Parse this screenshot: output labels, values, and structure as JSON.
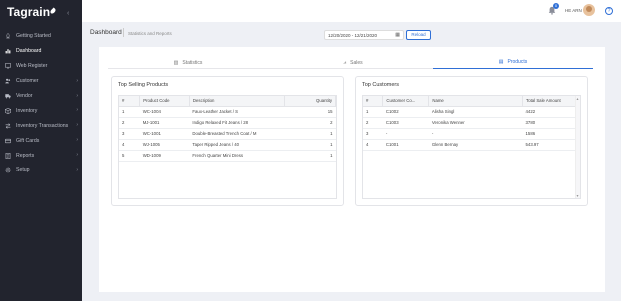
{
  "app": {
    "logo_text": "Tagrain"
  },
  "sidebar": {
    "items": [
      {
        "label": "Getting Started",
        "icon": "rocket-icon",
        "chevron": false
      },
      {
        "label": "Dashboard",
        "icon": "bar-chart-icon",
        "chevron": false,
        "active": true
      },
      {
        "label": "Web Register",
        "icon": "monitor-icon",
        "chevron": false
      },
      {
        "label": "Customer",
        "icon": "users-icon",
        "chevron": true
      },
      {
        "label": "Vendor",
        "icon": "truck-icon",
        "chevron": true
      },
      {
        "label": "Inventory",
        "icon": "box-icon",
        "chevron": true
      },
      {
        "label": "Inventory Transactions",
        "icon": "swap-icon",
        "chevron": true
      },
      {
        "label": "Gift Cards",
        "icon": "gift-card-icon",
        "chevron": true
      },
      {
        "label": "Reports",
        "icon": "report-icon",
        "chevron": true
      },
      {
        "label": "Setup",
        "icon": "gear-icon",
        "chevron": true
      }
    ]
  },
  "header": {
    "notification_count": "0",
    "user_name": "HE ARN",
    "help_label": "?"
  },
  "page": {
    "title": "Dashboard",
    "subtitle": "Statistics and Reports",
    "date_range": "12/20/2020 - 12/21/2020",
    "reload_label": "Reload"
  },
  "tabs": [
    {
      "label": "Statistics",
      "icon": "stats-icon"
    },
    {
      "label": "Sales",
      "icon": "line-chart-icon"
    },
    {
      "label": "Products",
      "icon": "products-icon",
      "active": true
    }
  ],
  "top_selling": {
    "title": "Top Selling Products",
    "columns": [
      "#",
      "Product Code",
      "Description",
      "Quantity"
    ],
    "rows": [
      [
        "1",
        "WC-1004",
        "Faux-Leather Jacket / S",
        "15"
      ],
      [
        "2",
        "MJ-1001",
        "Indigo Relaxed Fit Jeans / 28",
        "2"
      ],
      [
        "3",
        "WC-1001",
        "Double-Breasted Trench Coat / M",
        "1"
      ],
      [
        "4",
        "WJ-1005",
        "Taper Ripped Jeans / 40",
        "1"
      ],
      [
        "5",
        "WD-1009",
        "French Quarter Mini Dress",
        "1"
      ]
    ]
  },
  "top_customers": {
    "title": "Top Customers",
    "columns": [
      "#",
      "Customer Co...",
      "Name",
      "Total Sale Amount"
    ],
    "rows": [
      [
        "1",
        "C1002",
        "Alisha Singl",
        "4422"
      ],
      [
        "2",
        "C1003",
        "Veronika Wenner",
        "3780"
      ],
      [
        "3",
        "-",
        "-",
        "1586"
      ],
      [
        "4",
        "C1001",
        "Glenn Bernay",
        "543.97"
      ]
    ]
  }
}
